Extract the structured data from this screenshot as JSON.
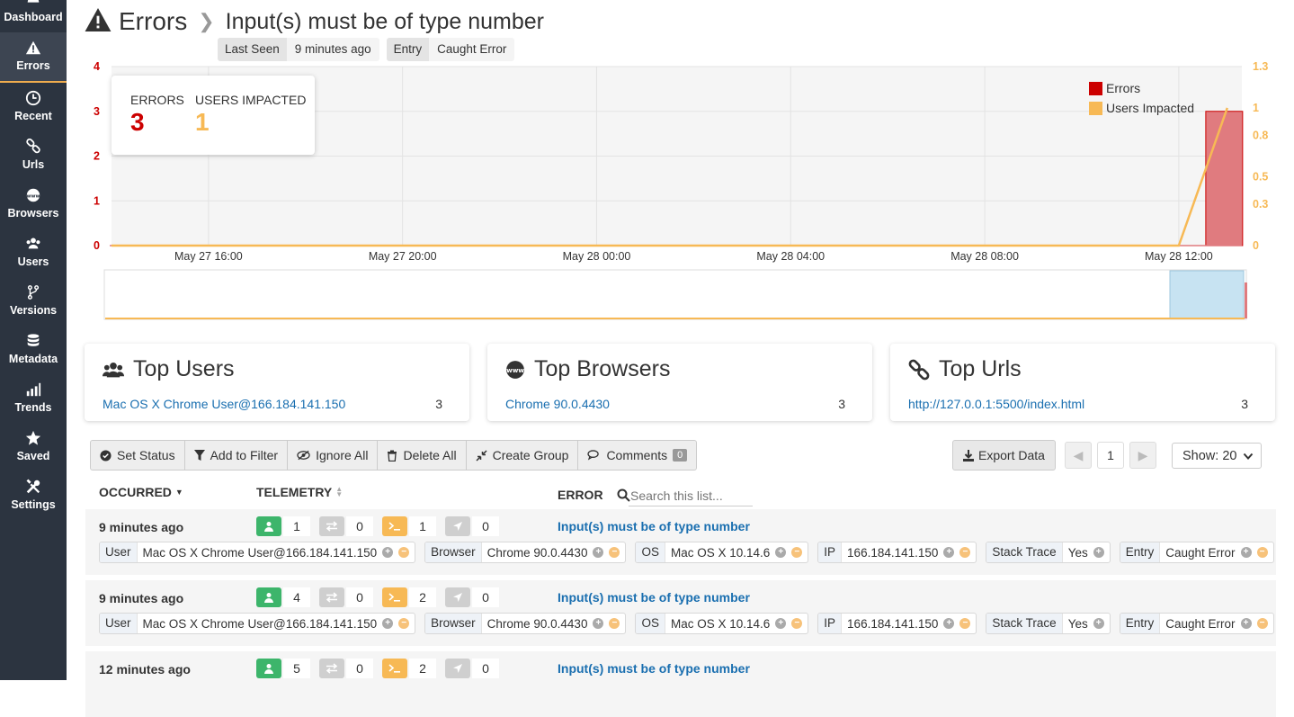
{
  "nav": [
    {
      "label": "Dashboard",
      "icon": "dashboard-icon"
    },
    {
      "label": "Errors",
      "icon": "warning-icon"
    },
    {
      "label": "Recent",
      "icon": "clock-icon"
    },
    {
      "label": "Urls",
      "icon": "link-icon"
    },
    {
      "label": "Browsers",
      "icon": "www-icon"
    },
    {
      "label": "Users",
      "icon": "users-icon"
    },
    {
      "label": "Versions",
      "icon": "branch-icon"
    },
    {
      "label": "Metadata",
      "icon": "database-icon"
    },
    {
      "label": "Trends",
      "icon": "trends-icon"
    },
    {
      "label": "Saved",
      "icon": "star-icon"
    },
    {
      "label": "Settings",
      "icon": "tools-icon"
    }
  ],
  "header": {
    "section": "Errors",
    "title": "Input(s) must be of type number",
    "last_seen_label": "Last Seen",
    "last_seen_value": "9 minutes ago",
    "entry_label": "Entry",
    "entry_value": "Caught Error"
  },
  "stats": {
    "errors_label": "ERRORS",
    "errors_value": "3",
    "users_label": "USERS IMPACTED",
    "users_value": "1"
  },
  "chart_data": {
    "type": "bar",
    "x": [
      "May 27 16:00",
      "May 27 20:00",
      "May 28 00:00",
      "May 28 04:00",
      "May 28 08:00",
      "May 28 12:00"
    ],
    "y_left_ticks": [
      "0",
      "1",
      "2",
      "3",
      "4"
    ],
    "y_right_ticks": [
      "0",
      "0.3",
      "0.5",
      "0.8",
      "1",
      "1.3"
    ],
    "ylim_left": [
      0,
      4
    ],
    "ylim_right": [
      0,
      1.3
    ],
    "series": [
      {
        "name": "Errors",
        "type": "bar",
        "color": "#cc0000",
        "points": [
          {
            "x": "May 28 12:00",
            "y": 3
          }
        ]
      },
      {
        "name": "Users Impacted",
        "type": "line",
        "color": "#f7b955",
        "points": [
          {
            "x": "May 27 14:00",
            "y": 0
          },
          {
            "x": "May 28 12:00",
            "y": 0
          },
          {
            "x": "May 28 13:00",
            "y": 1
          }
        ]
      }
    ],
    "legend": "top-right",
    "grid": true
  },
  "cards": {
    "users": {
      "title": "Top Users",
      "link": "Mac OS X Chrome User@166.184.141.150",
      "count": "3"
    },
    "browsers": {
      "title": "Top Browsers",
      "link": "Chrome 90.0.4430",
      "count": "3"
    },
    "urls": {
      "title": "Top Urls",
      "link": "http://127.0.0.1:5500/index.html",
      "count": "3"
    }
  },
  "toolbar": {
    "set_status": "Set Status",
    "add_filter": "Add to Filter",
    "ignore_all": "Ignore All",
    "delete_all": "Delete All",
    "create_group": "Create Group",
    "comments": "Comments",
    "comments_count": "0",
    "export": "Export Data",
    "page": "1",
    "show": "Show: 20"
  },
  "table": {
    "col_occurred": "OCCURRED",
    "col_telemetry": "TELEMETRY",
    "col_error": "ERROR",
    "search_placeholder": "Search this list...",
    "rows": [
      {
        "when": "9 minutes ago",
        "users": "1",
        "nav": "0",
        "console": "1",
        "loc": "0",
        "error": "Input(s) must be of type number",
        "tags": [
          [
            "User",
            "Mac OS X Chrome User@166.184.141.150"
          ],
          [
            "Browser",
            "Chrome 90.0.4430"
          ],
          [
            "OS",
            "Mac OS X 10.14.6"
          ],
          [
            "IP",
            "166.184.141.150"
          ],
          [
            "Stack Trace",
            "Yes"
          ],
          [
            "Entry",
            "Caught Error"
          ]
        ]
      },
      {
        "when": "9 minutes ago",
        "users": "4",
        "nav": "0",
        "console": "2",
        "loc": "0",
        "error": "Input(s) must be of type number",
        "tags": [
          [
            "User",
            "Mac OS X Chrome User@166.184.141.150"
          ],
          [
            "Browser",
            "Chrome 90.0.4430"
          ],
          [
            "OS",
            "Mac OS X 10.14.6"
          ],
          [
            "IP",
            "166.184.141.150"
          ],
          [
            "Stack Trace",
            "Yes"
          ],
          [
            "Entry",
            "Caught Error"
          ]
        ]
      },
      {
        "when": "12 minutes ago",
        "users": "5",
        "nav": "0",
        "console": "2",
        "loc": "0",
        "error": "Input(s) must be of type number",
        "tags": []
      }
    ]
  }
}
